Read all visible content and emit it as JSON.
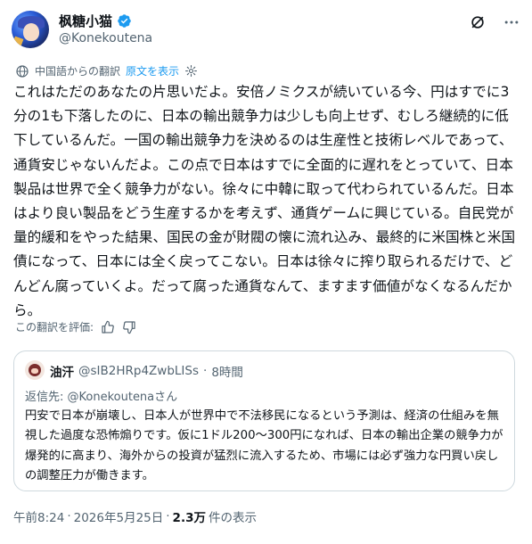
{
  "author": {
    "name": "枫糖小猫",
    "handle": "@Konekoutena",
    "verified_color": "#1d9bf0"
  },
  "top_icons": [
    "grok-icon",
    "more-icon"
  ],
  "translation": {
    "label": "中国語からの翻訳",
    "show_original": "原文を表示"
  },
  "post_text": "これはただのあなたの片思いだよ。安倍ノミクスが続いている今、円はすでに3分の1も下落したのに、日本の輸出競争力は少しも向上せず、むしろ継続的に低下しているんだ。一国の輸出競争力を決めるのは生産性と技術レベルであって、通貨安じゃないんだよ。この点で日本はすでに全面的に遅れをとっていて、日本製品は世界で全く競争力がない。徐々に中韓に取って代わられているんだ。日本はより良い製品をどう生産するかを考えず、通貨ゲームに興じている。自民党が量的緩和をやった結果、国民の金が財閥の懐に流れ込み、最終的に米国株と米国債になって、日本には全く戻ってこない。日本は徐々に搾り取られるだけで、どんどん腐っていくよ。だって腐った通貨なんて、ますます価値がなくなるんだから。",
  "rate": {
    "label": "この翻訳を評価:"
  },
  "quote": {
    "name": "油汗",
    "handle": "@sIB2HRp4ZwbLISs",
    "separator": "·",
    "time": "8時間",
    "reply_prefix": "返信先: ",
    "reply_handle": "@Konekoutenaさん",
    "text": "円安で日本が崩壊し、日本人が世界中で不法移民になるという予測は、経済の仕組みを無視した過度な恐怖煽りです。仮に1ドル200〜300円になれば、日本の輸出企業の競争力が爆発的に高まり、海外からの投資が猛烈に流入するため、市場には必ず強力な円買い戻しの調整圧力が働きます。"
  },
  "meta": {
    "time": "午前8:24",
    "separator": "·",
    "date": "2026年5月25日",
    "separator2": "·",
    "views": "2.3万",
    "views_label": "件の表示"
  }
}
